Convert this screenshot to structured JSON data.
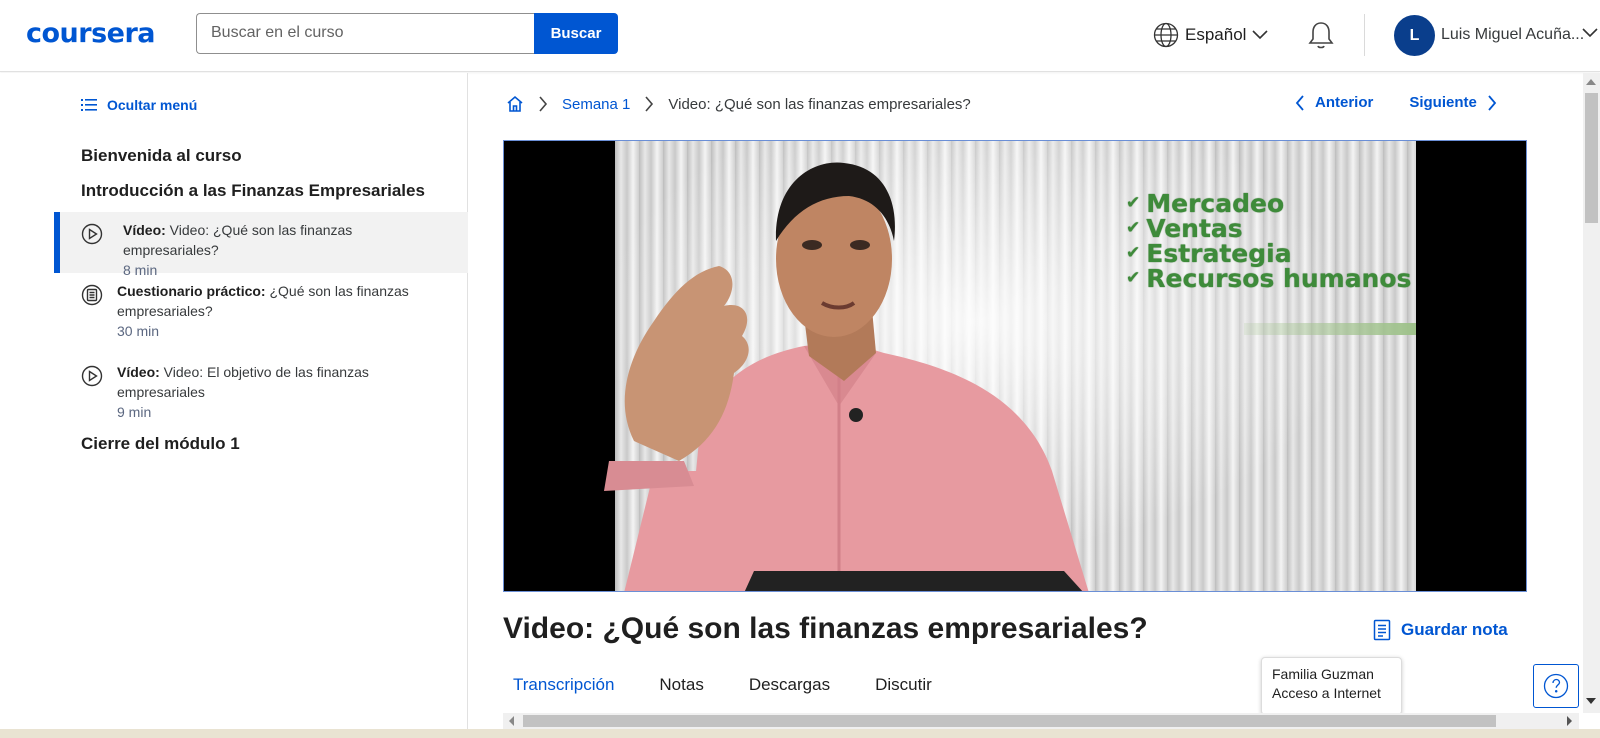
{
  "header": {
    "logo_text": "coursera",
    "search_placeholder": "Buscar en el curso",
    "search_button": "Buscar",
    "language": "Español",
    "avatar_initial": "L",
    "user_name": "Luis Miguel Acuña..."
  },
  "sidebar": {
    "hide_menu": "Ocultar menú",
    "sections": {
      "welcome": "Bienvenida al curso",
      "intro": "Introducción a las Finanzas Empresariales",
      "closing": "Cierre del módulo 1"
    },
    "lessons": [
      {
        "type": "Vídeo:",
        "title": " Video: ¿Qué son las finanzas empresariales?",
        "duration": "8 min",
        "icon": "play-circle-icon",
        "active": true
      },
      {
        "type": "Cuestionario práctico:",
        "title": " ¿Qué son las finanzas empresariales?",
        "duration": "30 min",
        "icon": "quiz-icon",
        "active": false
      },
      {
        "type": "Vídeo:",
        "title": " Video: El objetivo de las finanzas empresariales",
        "duration": "9 min",
        "icon": "play-circle-icon",
        "active": false
      }
    ]
  },
  "breadcrumb": {
    "week": "Semana 1",
    "current": "Video: ¿Qué son las finanzas empresariales?"
  },
  "nav": {
    "previous": "Anterior",
    "next": "Siguiente"
  },
  "video": {
    "bullets": [
      "Mercadeo",
      "Ventas",
      "Estrategia",
      "Recursos humanos"
    ]
  },
  "title": "Video: ¿Qué son las finanzas empresariales?",
  "save_note": "Guardar nota",
  "tabs": [
    "Transcripción",
    "Notas",
    "Descargas",
    "Discutir"
  ],
  "tooltip": {
    "line1": "Familia Guzman",
    "line2": "Acceso a Internet"
  },
  "colors": {
    "brand": "#0056d2",
    "bullet_green": "#3e8b3a"
  }
}
